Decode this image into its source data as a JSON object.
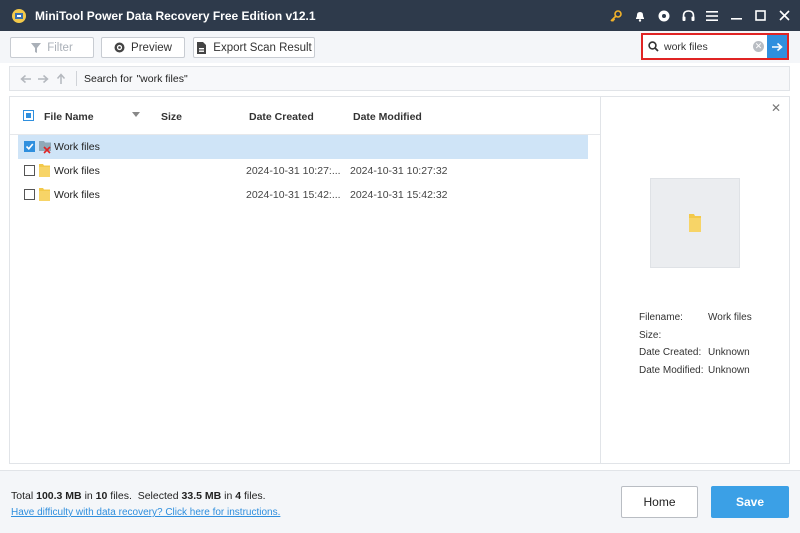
{
  "app": {
    "title": "MiniTool Power Data Recovery Free Edition v12.1"
  },
  "titlebar": {
    "icons": [
      "key-icon",
      "bell-icon",
      "disc-icon",
      "headset-icon",
      "menu-icon",
      "minimize-icon",
      "maximize-icon",
      "close-icon"
    ]
  },
  "toolbar": {
    "filter_label": "Filter",
    "preview_label": "Preview",
    "export_label": "Export Scan Result"
  },
  "search": {
    "value": "work files"
  },
  "nav": {
    "label": "Search for",
    "query": "\"work files\""
  },
  "table": {
    "headers": {
      "name": "File Name",
      "size": "Size",
      "created": "Date Created",
      "modified": "Date Modified"
    },
    "rows": [
      {
        "name": "Work files",
        "size": "",
        "created": "",
        "modified": "",
        "checked": true,
        "selected": true
      },
      {
        "name": "Work files",
        "size": "",
        "created": "2024-10-31 10:27:...",
        "modified": "2024-10-31 10:27:32",
        "checked": false,
        "selected": false
      },
      {
        "name": "Work files",
        "size": "",
        "created": "2024-10-31 15:42:...",
        "modified": "2024-10-31 15:42:32",
        "checked": false,
        "selected": false
      }
    ]
  },
  "preview": {
    "filename_label": "Filename:",
    "filename_value": "Work files",
    "size_label": "Size:",
    "size_value": "",
    "created_label": "Date Created:",
    "created_value": "Unknown",
    "modified_label": "Date Modified:",
    "modified_value": "Unknown"
  },
  "footer": {
    "total_prefix": "Total",
    "total_size": "100.3 MB",
    "in1": "in",
    "total_files": "10",
    "files1": "files.",
    "selected_prefix": "Selected",
    "selected_size": "33.5 MB",
    "in2": "in",
    "selected_files": "4",
    "files2": "files.",
    "help_link": "Have difficulty with data recovery? Click here for instructions.",
    "home_label": "Home",
    "save_label": "Save"
  },
  "colors": {
    "titlebar_bg": "#2e3a4b",
    "accent": "#2f8fde",
    "highlight_border": "#e02424",
    "save_bg": "#3ba0e6",
    "selected_row": "#cfe4f7",
    "folder": "#f3c94a"
  }
}
